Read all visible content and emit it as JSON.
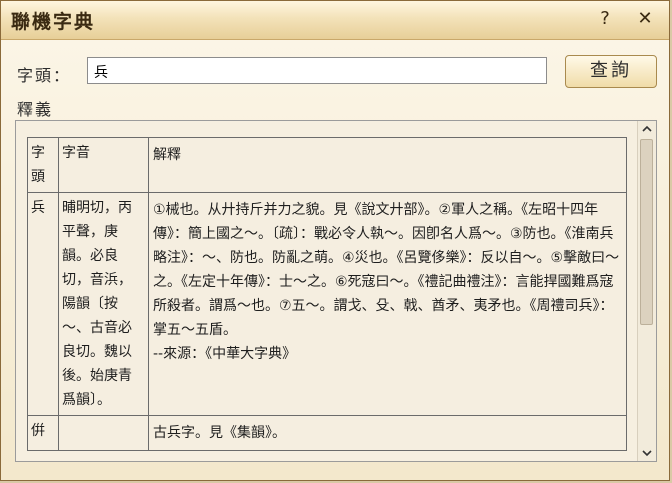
{
  "window": {
    "title": "聯機字典",
    "help_label": "?",
    "close_label": "✕"
  },
  "search": {
    "label": "字頭：",
    "value": "兵",
    "button_label": "查詢"
  },
  "definition": {
    "section_label": "釋義",
    "headers": {
      "char": "字頭",
      "pron": "字音",
      "expl": "解釋"
    },
    "rows": [
      {
        "char": "兵",
        "pron": "晡明切，丙平聲，庚韻。必良切，音浜，陽韻〔按～、古音必良切。魏以後。始庚青爲韻〕。",
        "expl_lines": [
          "①械也。从廾持斤并力之貌。見《說文廾部》。②軍人之稱。《左昭十四年傳》：簡上國之～。〔疏〕：戰必令人執～。因卽名人爲～。③防也。《淮南兵略注》：～、防也。防亂之萌。④災也。《呂覽侈樂》：反以自～。⑤擊敵曰～之。《左定十年傳》：士～之。⑥死寇曰～。《禮記曲禮注》：言能捍國難爲寇所殺者。謂爲～也。⑦五～。謂戈、殳、戟、酋矛、夷矛也。《周禮司兵》：掌五～五盾。",
          "--來源：《中華大字典》"
        ]
      },
      {
        "char": "倂",
        "pron": "",
        "expl_lines": [
          "古兵字。見《集韻》。"
        ]
      }
    ]
  },
  "icons": {
    "scroll_up": "chevron-up-icon",
    "scroll_down": "chevron-down-icon"
  }
}
